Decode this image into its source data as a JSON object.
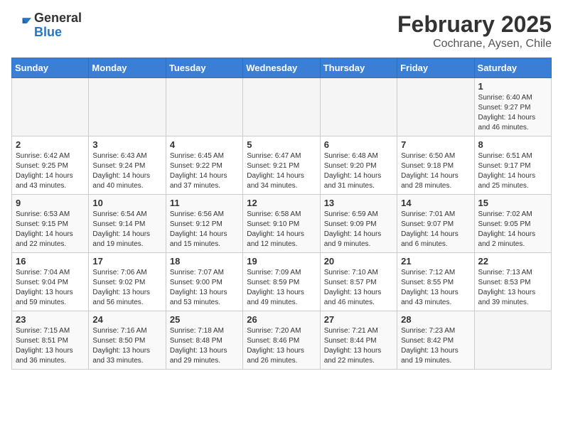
{
  "header": {
    "logo_general": "General",
    "logo_blue": "Blue",
    "title": "February 2025",
    "subtitle": "Cochrane, Aysen, Chile"
  },
  "weekdays": [
    "Sunday",
    "Monday",
    "Tuesday",
    "Wednesday",
    "Thursday",
    "Friday",
    "Saturday"
  ],
  "weeks": [
    [
      {
        "day": "",
        "info": ""
      },
      {
        "day": "",
        "info": ""
      },
      {
        "day": "",
        "info": ""
      },
      {
        "day": "",
        "info": ""
      },
      {
        "day": "",
        "info": ""
      },
      {
        "day": "",
        "info": ""
      },
      {
        "day": "1",
        "info": "Sunrise: 6:40 AM\nSunset: 9:27 PM\nDaylight: 14 hours and 46 minutes."
      }
    ],
    [
      {
        "day": "2",
        "info": "Sunrise: 6:42 AM\nSunset: 9:25 PM\nDaylight: 14 hours and 43 minutes."
      },
      {
        "day": "3",
        "info": "Sunrise: 6:43 AM\nSunset: 9:24 PM\nDaylight: 14 hours and 40 minutes."
      },
      {
        "day": "4",
        "info": "Sunrise: 6:45 AM\nSunset: 9:22 PM\nDaylight: 14 hours and 37 minutes."
      },
      {
        "day": "5",
        "info": "Sunrise: 6:47 AM\nSunset: 9:21 PM\nDaylight: 14 hours and 34 minutes."
      },
      {
        "day": "6",
        "info": "Sunrise: 6:48 AM\nSunset: 9:20 PM\nDaylight: 14 hours and 31 minutes."
      },
      {
        "day": "7",
        "info": "Sunrise: 6:50 AM\nSunset: 9:18 PM\nDaylight: 14 hours and 28 minutes."
      },
      {
        "day": "8",
        "info": "Sunrise: 6:51 AM\nSunset: 9:17 PM\nDaylight: 14 hours and 25 minutes."
      }
    ],
    [
      {
        "day": "9",
        "info": "Sunrise: 6:53 AM\nSunset: 9:15 PM\nDaylight: 14 hours and 22 minutes."
      },
      {
        "day": "10",
        "info": "Sunrise: 6:54 AM\nSunset: 9:14 PM\nDaylight: 14 hours and 19 minutes."
      },
      {
        "day": "11",
        "info": "Sunrise: 6:56 AM\nSunset: 9:12 PM\nDaylight: 14 hours and 15 minutes."
      },
      {
        "day": "12",
        "info": "Sunrise: 6:58 AM\nSunset: 9:10 PM\nDaylight: 14 hours and 12 minutes."
      },
      {
        "day": "13",
        "info": "Sunrise: 6:59 AM\nSunset: 9:09 PM\nDaylight: 14 hours and 9 minutes."
      },
      {
        "day": "14",
        "info": "Sunrise: 7:01 AM\nSunset: 9:07 PM\nDaylight: 14 hours and 6 minutes."
      },
      {
        "day": "15",
        "info": "Sunrise: 7:02 AM\nSunset: 9:05 PM\nDaylight: 14 hours and 2 minutes."
      }
    ],
    [
      {
        "day": "16",
        "info": "Sunrise: 7:04 AM\nSunset: 9:04 PM\nDaylight: 13 hours and 59 minutes."
      },
      {
        "day": "17",
        "info": "Sunrise: 7:06 AM\nSunset: 9:02 PM\nDaylight: 13 hours and 56 minutes."
      },
      {
        "day": "18",
        "info": "Sunrise: 7:07 AM\nSunset: 9:00 PM\nDaylight: 13 hours and 53 minutes."
      },
      {
        "day": "19",
        "info": "Sunrise: 7:09 AM\nSunset: 8:59 PM\nDaylight: 13 hours and 49 minutes."
      },
      {
        "day": "20",
        "info": "Sunrise: 7:10 AM\nSunset: 8:57 PM\nDaylight: 13 hours and 46 minutes."
      },
      {
        "day": "21",
        "info": "Sunrise: 7:12 AM\nSunset: 8:55 PM\nDaylight: 13 hours and 43 minutes."
      },
      {
        "day": "22",
        "info": "Sunrise: 7:13 AM\nSunset: 8:53 PM\nDaylight: 13 hours and 39 minutes."
      }
    ],
    [
      {
        "day": "23",
        "info": "Sunrise: 7:15 AM\nSunset: 8:51 PM\nDaylight: 13 hours and 36 minutes."
      },
      {
        "day": "24",
        "info": "Sunrise: 7:16 AM\nSunset: 8:50 PM\nDaylight: 13 hours and 33 minutes."
      },
      {
        "day": "25",
        "info": "Sunrise: 7:18 AM\nSunset: 8:48 PM\nDaylight: 13 hours and 29 minutes."
      },
      {
        "day": "26",
        "info": "Sunrise: 7:20 AM\nSunset: 8:46 PM\nDaylight: 13 hours and 26 minutes."
      },
      {
        "day": "27",
        "info": "Sunrise: 7:21 AM\nSunset: 8:44 PM\nDaylight: 13 hours and 22 minutes."
      },
      {
        "day": "28",
        "info": "Sunrise: 7:23 AM\nSunset: 8:42 PM\nDaylight: 13 hours and 19 minutes."
      },
      {
        "day": "",
        "info": ""
      }
    ]
  ]
}
